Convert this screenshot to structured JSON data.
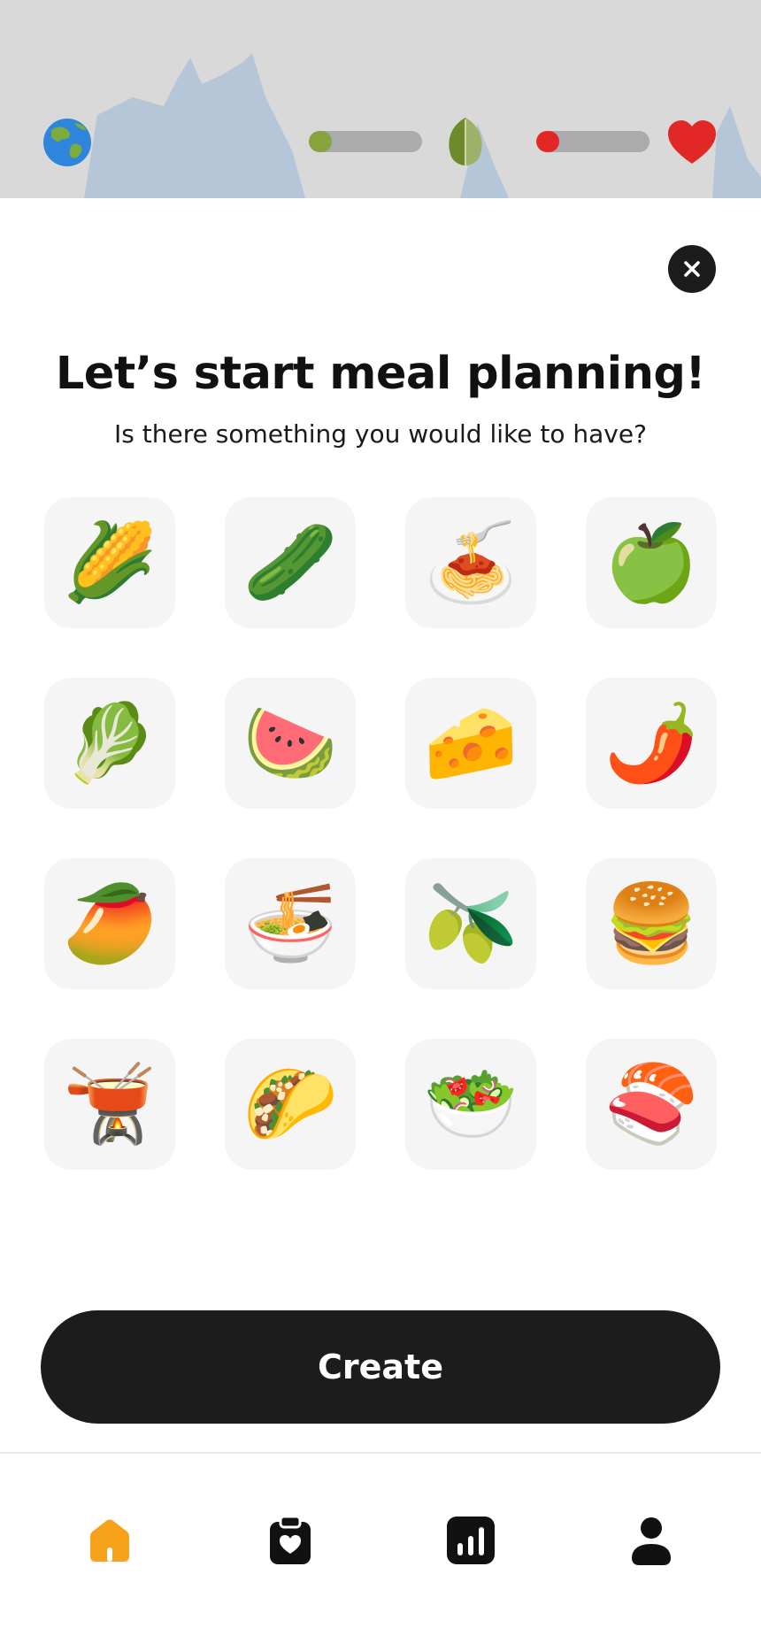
{
  "top_status": {
    "globe_icon": "earth-globe-icon",
    "green_progress": 0.2,
    "green_color": "#86a33c",
    "leaf_icon": "olive-leaf-icon",
    "red_progress": 0.2,
    "red_color": "#e22727",
    "heart_icon": "heart-icon"
  },
  "dialog": {
    "close_icon": "close-icon",
    "title": "Let’s start meal planning!",
    "subtitle": "Is there something you would like to have?",
    "foods": [
      {
        "name": "corn",
        "emoji": "🌽"
      },
      {
        "name": "cucumber",
        "emoji": "🥒"
      },
      {
        "name": "spaghetti",
        "emoji": "🍝"
      },
      {
        "name": "green-apple",
        "emoji": "🍏"
      },
      {
        "name": "leafy-green",
        "emoji": "🥬"
      },
      {
        "name": "watermelon",
        "emoji": "🍉"
      },
      {
        "name": "cheese",
        "emoji": "🧀"
      },
      {
        "name": "hot-pepper",
        "emoji": "🌶️"
      },
      {
        "name": "mango",
        "emoji": "🥭"
      },
      {
        "name": "noodle-soup",
        "emoji": "🍜"
      },
      {
        "name": "olive",
        "emoji": "🫒"
      },
      {
        "name": "hamburger",
        "emoji": "🍔"
      },
      {
        "name": "fondue",
        "emoji": "🫕"
      },
      {
        "name": "taco",
        "emoji": "🌮"
      },
      {
        "name": "green-salad",
        "emoji": "🥗"
      },
      {
        "name": "sushi",
        "emoji": "🍣"
      }
    ],
    "create_label": "Create"
  },
  "bottom_nav": {
    "active_color": "#f7a21b",
    "items": [
      {
        "icon": "home-icon",
        "active": true
      },
      {
        "icon": "clipboard-heart-icon",
        "active": false
      },
      {
        "icon": "bar-chart-icon",
        "active": false
      },
      {
        "icon": "profile-icon",
        "active": false
      }
    ]
  }
}
